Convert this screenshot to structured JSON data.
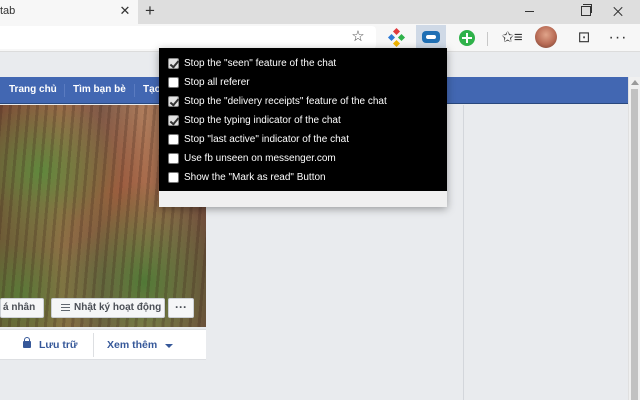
{
  "browser": {
    "tab_title": "tab",
    "tab_close": "✕",
    "new_tab": "+",
    "star": "☆",
    "favorites": "✩≡",
    "feedback": "⊡",
    "menu": "···"
  },
  "facebook": {
    "nav": [
      "Trang chủ",
      "Tìm bạn bè",
      "Tạo"
    ],
    "cover_buttons": {
      "profile": "á nhân",
      "activity_log": "Nhật ký hoạt động",
      "more": "···"
    },
    "timeline": {
      "archive": "Lưu trữ",
      "see_more": "Xem thêm"
    }
  },
  "popup": {
    "options": [
      {
        "label": "Stop the \"seen\" feature of the chat",
        "checked": true
      },
      {
        "label": "Stop all referer",
        "checked": false
      },
      {
        "label": "Stop the \"delivery receipts\" feature of the chat",
        "checked": true
      },
      {
        "label": "Stop the typing indicator of the chat",
        "checked": true
      },
      {
        "label": "Stop \"last active\" indicator of the chat",
        "checked": false
      },
      {
        "label": "Use fb unseen on messenger.com",
        "checked": false
      },
      {
        "label": "Show the \"Mark as read\" Button",
        "checked": false
      }
    ]
  },
  "colors": {
    "facebook_blue": "#4267b2",
    "popup_background": "#000000",
    "extension_badge": "#1f6fb4"
  }
}
